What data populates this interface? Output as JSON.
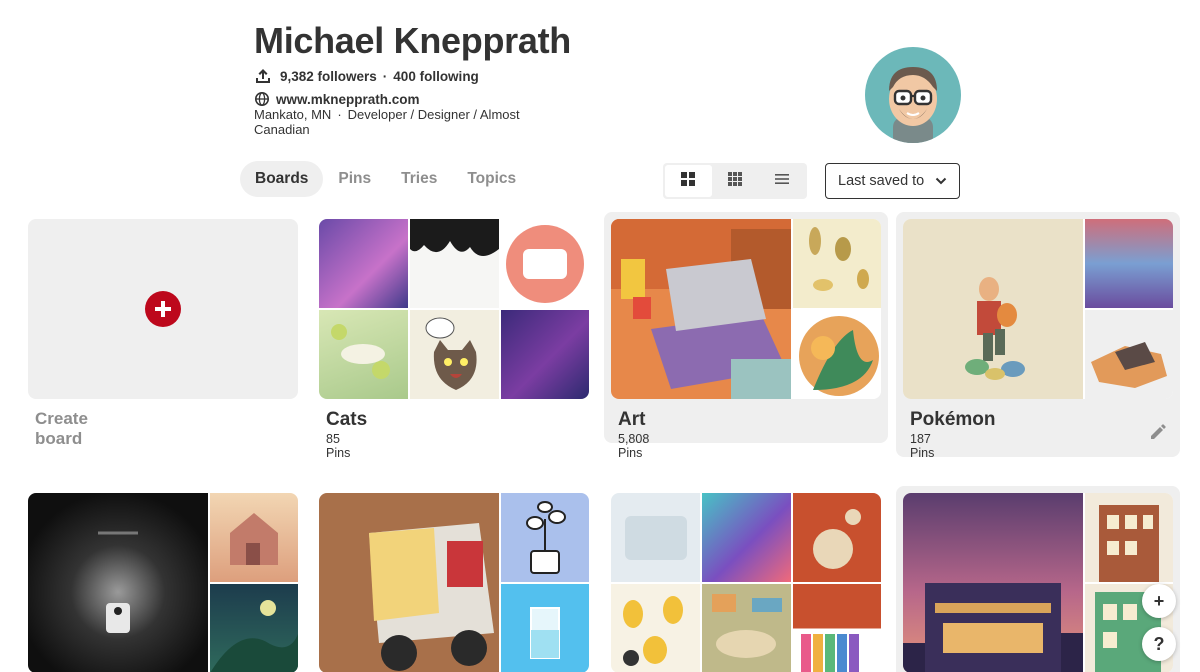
{
  "profile": {
    "name": "Michael Knepprath",
    "followers": "9,382 followers",
    "following": "400 following",
    "separator": "·",
    "website": "www.mknepprath.com",
    "location": "Mankato, MN",
    "bio": "Developer / Designer / Almost Canadian"
  },
  "tabs": [
    {
      "label": "Boards",
      "active": true
    },
    {
      "label": "Pins",
      "active": false
    },
    {
      "label": "Tries",
      "active": false
    },
    {
      "label": "Topics",
      "active": false
    }
  ],
  "view_modes": [
    "large-grid-icon",
    "small-grid-icon",
    "list-icon"
  ],
  "sort": {
    "label": "Last saved to"
  },
  "create_board": {
    "label": "Create board"
  },
  "boards": [
    {
      "title": "Cats",
      "pins": "85 Pins"
    },
    {
      "title": "Art",
      "pins": "5,808 Pins"
    },
    {
      "title": "Pokémon",
      "pins": "187 Pins"
    }
  ],
  "floating": {
    "add": "+",
    "help": "?"
  },
  "colors": {
    "accent": "#bd081c",
    "tab_active_bg": "#efefef",
    "avatar_bg": "#6cb8b9"
  }
}
